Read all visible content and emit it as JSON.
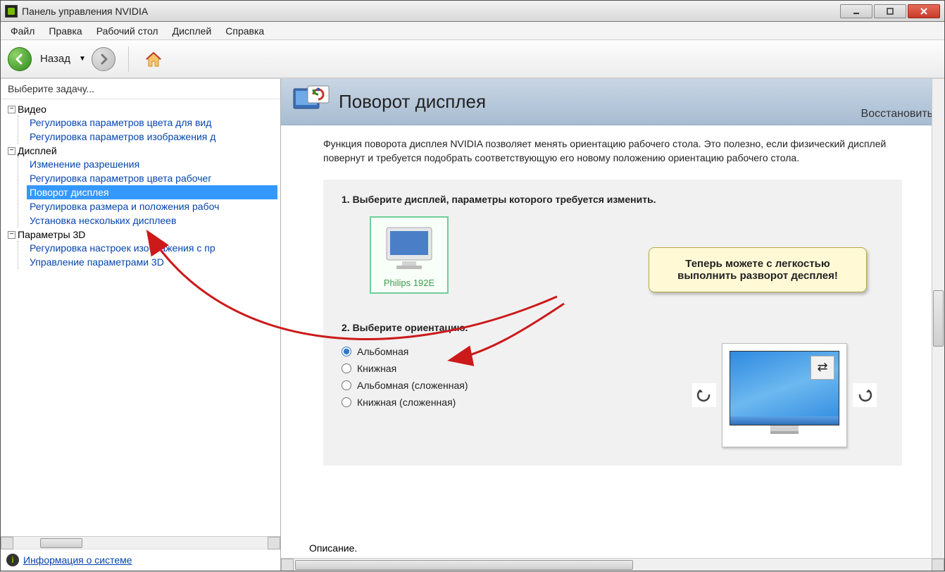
{
  "window": {
    "title": "Панель управления NVIDIA"
  },
  "menu": {
    "file": "Файл",
    "edit": "Правка",
    "desktop": "Рабочий стол",
    "display": "Дисплей",
    "help": "Справка"
  },
  "toolbar": {
    "back": "Назад"
  },
  "sidebar": {
    "header": "Выберите задачу...",
    "video": {
      "label": "Видео",
      "items": [
        "Регулировка параметров цвета для вид",
        "Регулировка параметров изображения д"
      ]
    },
    "display": {
      "label": "Дисплей",
      "items": [
        "Изменение разрешения",
        "Регулировка параметров цвета рабочег",
        "Поворот дисплея",
        "Регулировка размера и положения рабоч",
        "Установка нескольких дисплеев"
      ]
    },
    "settings3d": {
      "label": "Параметры 3D",
      "items": [
        "Регулировка настроек изображения с пр",
        "Управление параметрами 3D"
      ]
    },
    "system_info": "Информация о системе"
  },
  "main": {
    "title": "Поворот дисплея",
    "restore": "Восстановить",
    "description": "Функция поворота дисплея NVIDIA позволяет менять ориентацию рабочего стола. Это полезно, если физический дисплей повернут и требуется подобрать соответствующую его новому положению ориентацию рабочего стола.",
    "step1_title": "1. Выберите дисплей, параметры которого требуется изменить.",
    "monitor_label": "Philips 192E",
    "step2_title": "2. Выберите ориентацию.",
    "orientations": [
      "Альбомная",
      "Книжная",
      "Альбомная (сложенная)",
      "Книжная (сложенная)"
    ],
    "bottom_label": "Описание."
  },
  "callout": {
    "text": "Теперь можете с легкостью выполнить разворот десплея!"
  }
}
